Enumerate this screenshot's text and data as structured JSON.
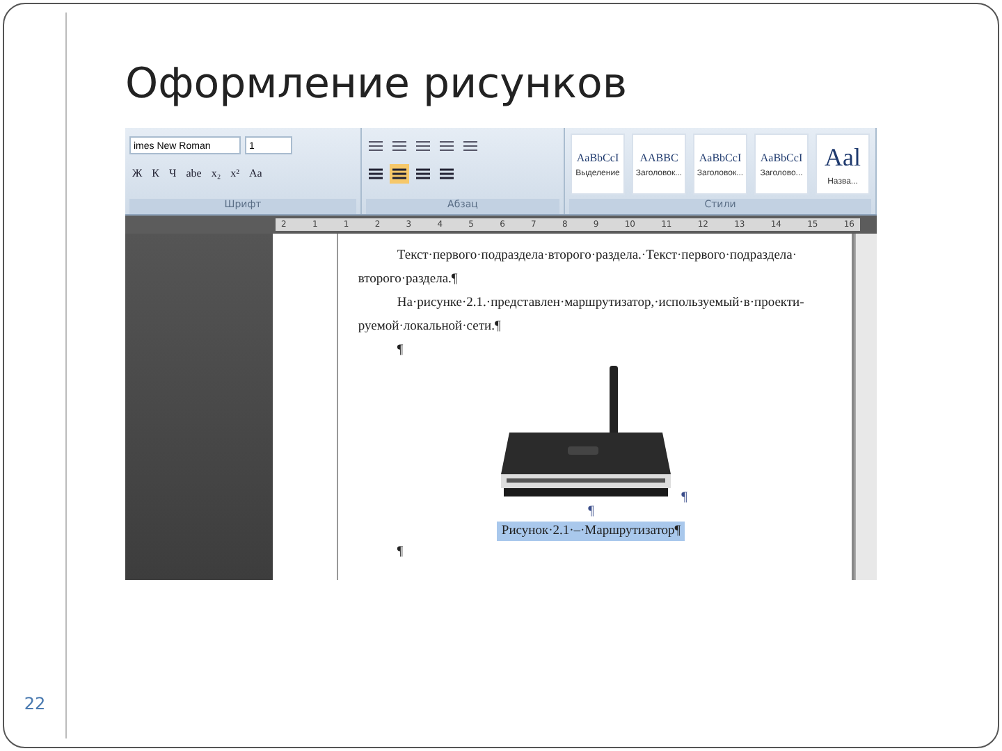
{
  "slide": {
    "title": "Оформление рисунков",
    "page_number": "22"
  },
  "ribbon": {
    "font_name": "imes New Roman",
    "font_size": "1",
    "format_buttons": [
      "Ж",
      "К",
      "Ч",
      "abe",
      "x₂",
      "x²",
      "Aa"
    ],
    "groups": [
      "Шрифт",
      "Абзац",
      "Стили"
    ],
    "styles": [
      {
        "preview": "AaBbCcI",
        "label": "Выделение"
      },
      {
        "preview": "AABBC",
        "label": "Заголовок..."
      },
      {
        "preview": "AaBbCcI",
        "label": "Заголовок..."
      },
      {
        "preview": "AaBbCcI",
        "label": "Заголово..."
      },
      {
        "preview": "Aal",
        "label": "Назва..."
      }
    ]
  },
  "ruler": {
    "ticks": [
      "2",
      "1",
      "1",
      "2",
      "3",
      "4",
      "5",
      "6",
      "7",
      "8",
      "9",
      "10",
      "11",
      "12",
      "13",
      "14",
      "15",
      "16"
    ]
  },
  "document": {
    "lines": [
      {
        "text": "Текст·первого·подраздела·второго·раздела.·Текст·первого·подраздела·",
        "indent": true
      },
      {
        "text": "второго·раздела.¶",
        "indent": false
      },
      {
        "text": "На·рисунке·2.1.·представлен·маршрутизатор,·используемый·в·проекти-",
        "indent": true
      },
      {
        "text": "руемой·локальной·сети.¶",
        "indent": false
      },
      {
        "text": "¶",
        "indent": true
      }
    ],
    "image_mark": "¶",
    "center_mark": "¶",
    "caption": {
      "text": "Рисунок·2.1·–·Маршрутизатор¶",
      "selected": true
    },
    "end_mark": "¶"
  }
}
